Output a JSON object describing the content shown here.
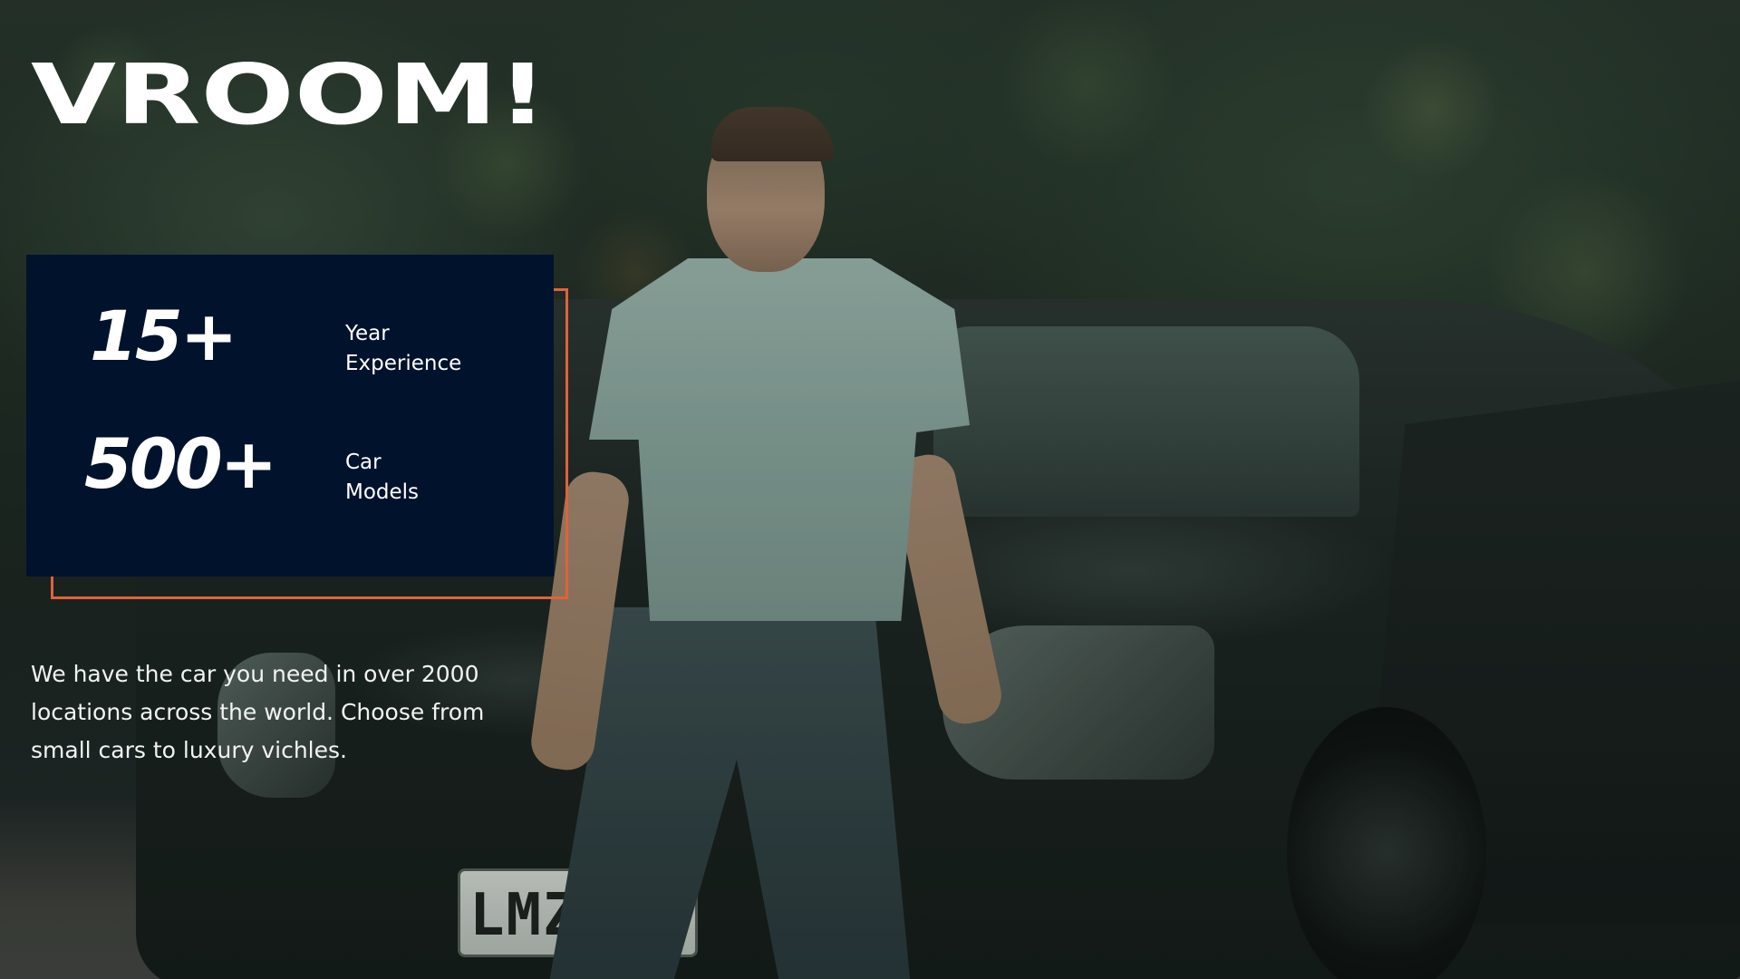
{
  "hero": {
    "title": "VROOM!"
  },
  "stats": [
    {
      "value": "15+",
      "label_line1": "Year",
      "label_line2": "Experience"
    },
    {
      "value": "500+",
      "label_line1": "Car",
      "label_line2": "Models"
    }
  ],
  "tagline": {
    "line1": "We have the car you need in over 2000",
    "line2": "locations across the world. Choose from",
    "line3": "small cars to luxury vichles."
  },
  "photo": {
    "license_plate": "LMZ  5"
  },
  "colors": {
    "panel_background": "#01132c",
    "accent_outline": "#e0623d",
    "text": "#ffffff"
  }
}
